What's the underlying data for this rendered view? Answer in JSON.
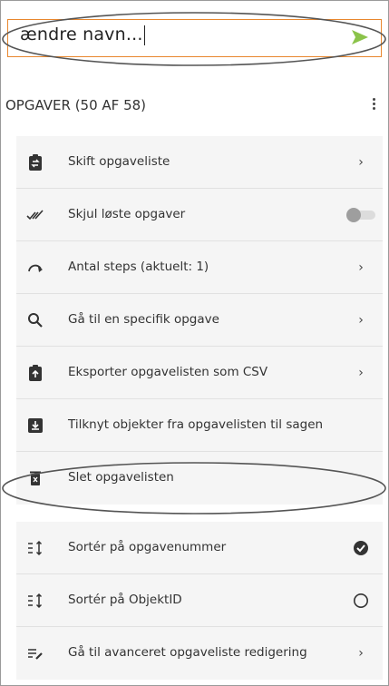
{
  "input": {
    "value": "ændre navn..."
  },
  "header": {
    "title": "OPGAVER (50 AF 58)"
  },
  "menu_top": [
    {
      "icon": "clipboard-swap-icon",
      "label": "Skift opgaveliste",
      "control": "chevron"
    },
    {
      "icon": "double-check-icon",
      "label": "Skjul løste opgaver",
      "control": "toggle",
      "toggle_on": false
    },
    {
      "icon": "steps-arrow-icon",
      "label": "Antal steps (aktuelt: 1)",
      "control": "chevron"
    },
    {
      "icon": "search-icon",
      "label": "Gå til en specifik opgave",
      "control": "chevron"
    },
    {
      "icon": "clipboard-export-icon",
      "label": "Eksporter opgavelisten som CSV",
      "control": "chevron"
    },
    {
      "icon": "download-box-icon",
      "label": "Tilknyt objekter fra opgavelisten til sagen",
      "control": "none"
    },
    {
      "icon": "trash-icon",
      "label": "Slet opgavelisten",
      "control": "none"
    }
  ],
  "menu_bottom": [
    {
      "icon": "sort-icon",
      "label": "Sortér på opgavenummer",
      "control": "check",
      "checked": true
    },
    {
      "icon": "sort-icon",
      "label": "Sortér på ObjektID",
      "control": "radio",
      "checked": false
    },
    {
      "icon": "edit-list-icon",
      "label": "Gå til avanceret opgaveliste redigering",
      "control": "chevron"
    }
  ],
  "colors": {
    "send": "#8bc34a",
    "input_border": "#e8872e",
    "menu_bg": "#f5f5f5"
  }
}
